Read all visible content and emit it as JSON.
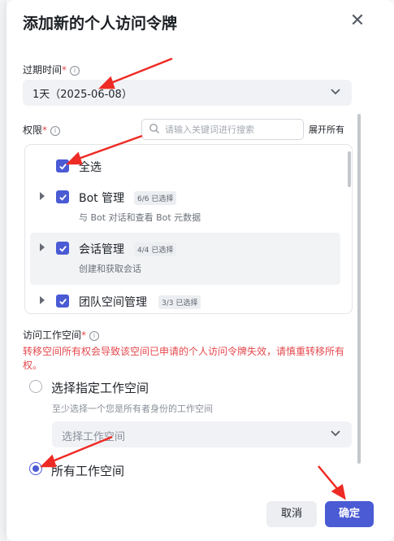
{
  "dialog": {
    "title": "添加新的个人访问令牌",
    "close_icon": "close-icon"
  },
  "expiry": {
    "label": "过期时间",
    "required_mark": "*",
    "info_icon": "info-icon",
    "value": "1天（2025-06-08）"
  },
  "permissions": {
    "label": "权限",
    "required_mark": "*",
    "info_icon": "info-icon",
    "search_placeholder": "请输入关键词进行搜索",
    "expand_all": "展开所有",
    "select_all": "全选",
    "items": [
      {
        "name": "Bot 管理",
        "badge": "6/6 已选择",
        "desc": "与 Bot 对话和查看 Bot 元数据"
      },
      {
        "name": "会话管理",
        "badge": "4/4 已选择",
        "desc": "创建和获取会话"
      },
      {
        "name": "团队空间管理",
        "badge": "3/3 已选择",
        "desc": ""
      }
    ]
  },
  "workspace": {
    "label": "访问工作空间",
    "required_mark": "*",
    "warning": "转移空间所有权会导致该空间已申请的个人访问令牌失效，请慎重转移所有权。",
    "option_specific": "选择指定工作空间",
    "hint": "至少选择一个您是所有者身份的工作空间",
    "select_placeholder": "选择工作空间",
    "option_all": "所有工作空间",
    "selected": "option_all"
  },
  "footer": {
    "cancel": "取消",
    "confirm": "确定"
  },
  "colors": {
    "accent": "#4a5bd4",
    "warning": "#e5484d",
    "annotation_arrow": "#ee2a24"
  }
}
